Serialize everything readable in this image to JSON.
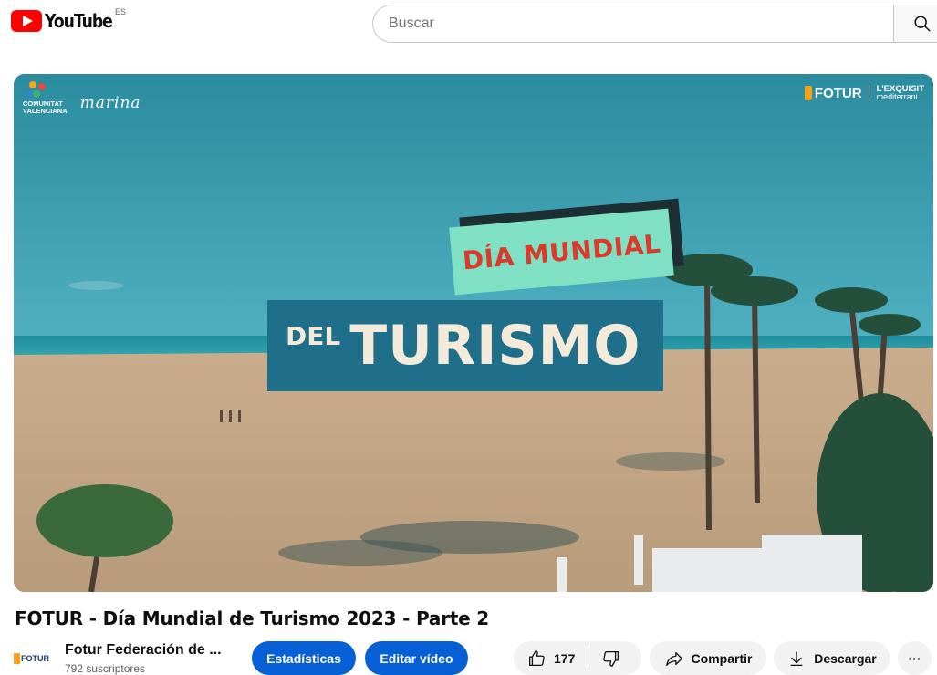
{
  "header": {
    "logo_text": "YouTube",
    "country_code": "ES",
    "search_placeholder": "Buscar"
  },
  "video": {
    "overlay_title_line1": "DÍA MUNDIAL",
    "overlay_title_small": "DEL",
    "overlay_title_line2": "TURISMO",
    "brand_left_line1": "COMUNITAT",
    "brand_left_line2": "VALENCIANA",
    "brand_marina": "marina",
    "brand_right_fotur": "FOTUR",
    "brand_right_exq1": "L'EXQUISIT",
    "brand_right_exq2": "mediterrani"
  },
  "meta": {
    "title": "FOTUR - Día Mundial de Turismo 2023 - Parte 2",
    "channel_avatar_text": "FOTUR",
    "channel_name": "Fotur Federación de ...",
    "subscribers": "792 suscriptores"
  },
  "actions": {
    "stats_label": "Estadísticas",
    "edit_label": "Editar vídeo",
    "like_count": "177",
    "share_label": "Compartir",
    "download_label": "Descargar",
    "more_label": "···"
  }
}
